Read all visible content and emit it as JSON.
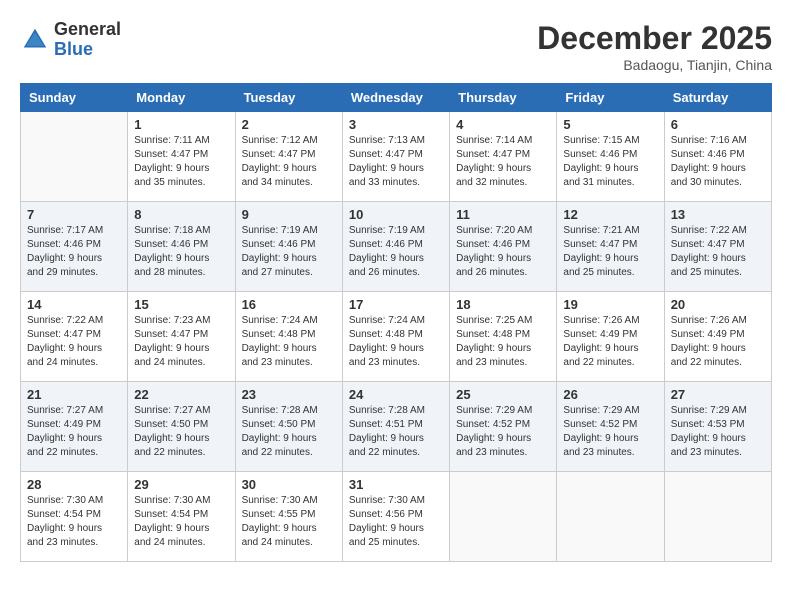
{
  "logo": {
    "general": "General",
    "blue": "Blue"
  },
  "title": "December 2025",
  "location": "Badaogu, Tianjin, China",
  "weekdays": [
    "Sunday",
    "Monday",
    "Tuesday",
    "Wednesday",
    "Thursday",
    "Friday",
    "Saturday"
  ],
  "weeks": [
    [
      {
        "day": "",
        "sunrise": "",
        "sunset": "",
        "daylight": ""
      },
      {
        "day": "1",
        "sunrise": "Sunrise: 7:11 AM",
        "sunset": "Sunset: 4:47 PM",
        "daylight": "Daylight: 9 hours and 35 minutes."
      },
      {
        "day": "2",
        "sunrise": "Sunrise: 7:12 AM",
        "sunset": "Sunset: 4:47 PM",
        "daylight": "Daylight: 9 hours and 34 minutes."
      },
      {
        "day": "3",
        "sunrise": "Sunrise: 7:13 AM",
        "sunset": "Sunset: 4:47 PM",
        "daylight": "Daylight: 9 hours and 33 minutes."
      },
      {
        "day": "4",
        "sunrise": "Sunrise: 7:14 AM",
        "sunset": "Sunset: 4:47 PM",
        "daylight": "Daylight: 9 hours and 32 minutes."
      },
      {
        "day": "5",
        "sunrise": "Sunrise: 7:15 AM",
        "sunset": "Sunset: 4:46 PM",
        "daylight": "Daylight: 9 hours and 31 minutes."
      },
      {
        "day": "6",
        "sunrise": "Sunrise: 7:16 AM",
        "sunset": "Sunset: 4:46 PM",
        "daylight": "Daylight: 9 hours and 30 minutes."
      }
    ],
    [
      {
        "day": "7",
        "sunrise": "Sunrise: 7:17 AM",
        "sunset": "Sunset: 4:46 PM",
        "daylight": "Daylight: 9 hours and 29 minutes."
      },
      {
        "day": "8",
        "sunrise": "Sunrise: 7:18 AM",
        "sunset": "Sunset: 4:46 PM",
        "daylight": "Daylight: 9 hours and 28 minutes."
      },
      {
        "day": "9",
        "sunrise": "Sunrise: 7:19 AM",
        "sunset": "Sunset: 4:46 PM",
        "daylight": "Daylight: 9 hours and 27 minutes."
      },
      {
        "day": "10",
        "sunrise": "Sunrise: 7:19 AM",
        "sunset": "Sunset: 4:46 PM",
        "daylight": "Daylight: 9 hours and 26 minutes."
      },
      {
        "day": "11",
        "sunrise": "Sunrise: 7:20 AM",
        "sunset": "Sunset: 4:46 PM",
        "daylight": "Daylight: 9 hours and 26 minutes."
      },
      {
        "day": "12",
        "sunrise": "Sunrise: 7:21 AM",
        "sunset": "Sunset: 4:47 PM",
        "daylight": "Daylight: 9 hours and 25 minutes."
      },
      {
        "day": "13",
        "sunrise": "Sunrise: 7:22 AM",
        "sunset": "Sunset: 4:47 PM",
        "daylight": "Daylight: 9 hours and 25 minutes."
      }
    ],
    [
      {
        "day": "14",
        "sunrise": "Sunrise: 7:22 AM",
        "sunset": "Sunset: 4:47 PM",
        "daylight": "Daylight: 9 hours and 24 minutes."
      },
      {
        "day": "15",
        "sunrise": "Sunrise: 7:23 AM",
        "sunset": "Sunset: 4:47 PM",
        "daylight": "Daylight: 9 hours and 24 minutes."
      },
      {
        "day": "16",
        "sunrise": "Sunrise: 7:24 AM",
        "sunset": "Sunset: 4:48 PM",
        "daylight": "Daylight: 9 hours and 23 minutes."
      },
      {
        "day": "17",
        "sunrise": "Sunrise: 7:24 AM",
        "sunset": "Sunset: 4:48 PM",
        "daylight": "Daylight: 9 hours and 23 minutes."
      },
      {
        "day": "18",
        "sunrise": "Sunrise: 7:25 AM",
        "sunset": "Sunset: 4:48 PM",
        "daylight": "Daylight: 9 hours and 23 minutes."
      },
      {
        "day": "19",
        "sunrise": "Sunrise: 7:26 AM",
        "sunset": "Sunset: 4:49 PM",
        "daylight": "Daylight: 9 hours and 22 minutes."
      },
      {
        "day": "20",
        "sunrise": "Sunrise: 7:26 AM",
        "sunset": "Sunset: 4:49 PM",
        "daylight": "Daylight: 9 hours and 22 minutes."
      }
    ],
    [
      {
        "day": "21",
        "sunrise": "Sunrise: 7:27 AM",
        "sunset": "Sunset: 4:49 PM",
        "daylight": "Daylight: 9 hours and 22 minutes."
      },
      {
        "day": "22",
        "sunrise": "Sunrise: 7:27 AM",
        "sunset": "Sunset: 4:50 PM",
        "daylight": "Daylight: 9 hours and 22 minutes."
      },
      {
        "day": "23",
        "sunrise": "Sunrise: 7:28 AM",
        "sunset": "Sunset: 4:50 PM",
        "daylight": "Daylight: 9 hours and 22 minutes."
      },
      {
        "day": "24",
        "sunrise": "Sunrise: 7:28 AM",
        "sunset": "Sunset: 4:51 PM",
        "daylight": "Daylight: 9 hours and 22 minutes."
      },
      {
        "day": "25",
        "sunrise": "Sunrise: 7:29 AM",
        "sunset": "Sunset: 4:52 PM",
        "daylight": "Daylight: 9 hours and 23 minutes."
      },
      {
        "day": "26",
        "sunrise": "Sunrise: 7:29 AM",
        "sunset": "Sunset: 4:52 PM",
        "daylight": "Daylight: 9 hours and 23 minutes."
      },
      {
        "day": "27",
        "sunrise": "Sunrise: 7:29 AM",
        "sunset": "Sunset: 4:53 PM",
        "daylight": "Daylight: 9 hours and 23 minutes."
      }
    ],
    [
      {
        "day": "28",
        "sunrise": "Sunrise: 7:30 AM",
        "sunset": "Sunset: 4:54 PM",
        "daylight": "Daylight: 9 hours and 23 minutes."
      },
      {
        "day": "29",
        "sunrise": "Sunrise: 7:30 AM",
        "sunset": "Sunset: 4:54 PM",
        "daylight": "Daylight: 9 hours and 24 minutes."
      },
      {
        "day": "30",
        "sunrise": "Sunrise: 7:30 AM",
        "sunset": "Sunset: 4:55 PM",
        "daylight": "Daylight: 9 hours and 24 minutes."
      },
      {
        "day": "31",
        "sunrise": "Sunrise: 7:30 AM",
        "sunset": "Sunset: 4:56 PM",
        "daylight": "Daylight: 9 hours and 25 minutes."
      },
      {
        "day": "",
        "sunrise": "",
        "sunset": "",
        "daylight": ""
      },
      {
        "day": "",
        "sunrise": "",
        "sunset": "",
        "daylight": ""
      },
      {
        "day": "",
        "sunrise": "",
        "sunset": "",
        "daylight": ""
      }
    ]
  ]
}
